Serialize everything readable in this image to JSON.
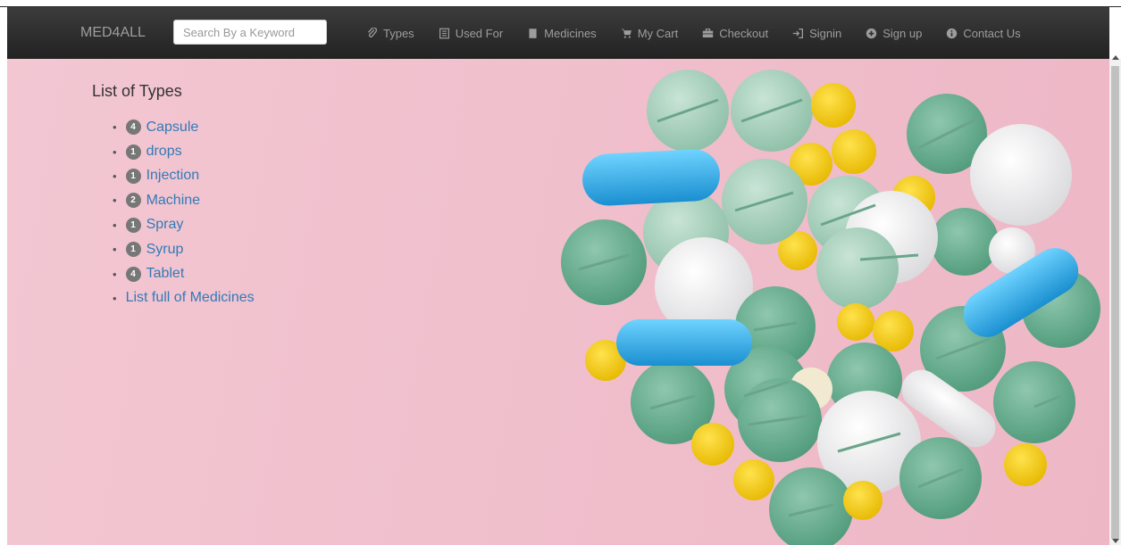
{
  "brand": "MED4ALL",
  "search": {
    "placeholder": "Search By a Keyword"
  },
  "nav": [
    {
      "label": "Types",
      "icon": "paperclip-icon"
    },
    {
      "label": "Used For",
      "icon": "list-icon"
    },
    {
      "label": "Medicines",
      "icon": "book-icon"
    },
    {
      "label": "My Cart",
      "icon": "cart-icon"
    },
    {
      "label": "Checkout",
      "icon": "briefcase-icon"
    },
    {
      "label": "Signin",
      "icon": "login-icon"
    },
    {
      "label": "Sign up",
      "icon": "plus-circle-icon"
    },
    {
      "label": "Contact Us",
      "icon": "info-circle-icon"
    }
  ],
  "list_title": "List of Types",
  "types": [
    {
      "count": "4",
      "name": "Capsule"
    },
    {
      "count": "1",
      "name": "drops"
    },
    {
      "count": "1",
      "name": "Injection"
    },
    {
      "count": "2",
      "name": "Machine"
    },
    {
      "count": "1",
      "name": "Spray"
    },
    {
      "count": "1",
      "name": "Syrup"
    },
    {
      "count": "4",
      "name": "Tablet"
    }
  ],
  "full_list_link": "List full of Medicines",
  "colors": {
    "navbar": "#222222",
    "nav_text": "#9d9d9d",
    "link": "#337ab7",
    "badge": "#777777",
    "background": "#f0bfcc"
  }
}
